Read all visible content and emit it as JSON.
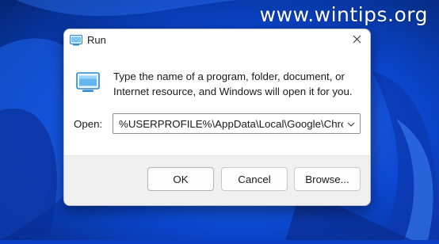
{
  "watermark": {
    "text": "www.wintips.org"
  },
  "dialog": {
    "title": "Run",
    "description_line1": "Type the name of a program, folder, document, or",
    "description_line2": "Internet resource, and Windows will open it for you.",
    "open_label": "Open:",
    "open_value": "%USERPROFILE%\\AppData\\Local\\Google\\Chrome\\U",
    "buttons": {
      "ok": "OK",
      "cancel": "Cancel",
      "browse": "Browse..."
    }
  },
  "icons": {
    "title_icon": "run-icon",
    "close_icon": "close-icon",
    "dropdown_icon": "chevron-down-icon"
  },
  "colors": {
    "desktop_bg": "#0a3fc4",
    "accent": "#1f78d1",
    "dialog_bg": "#ffffff",
    "footer_bg": "#f0f0f0"
  }
}
